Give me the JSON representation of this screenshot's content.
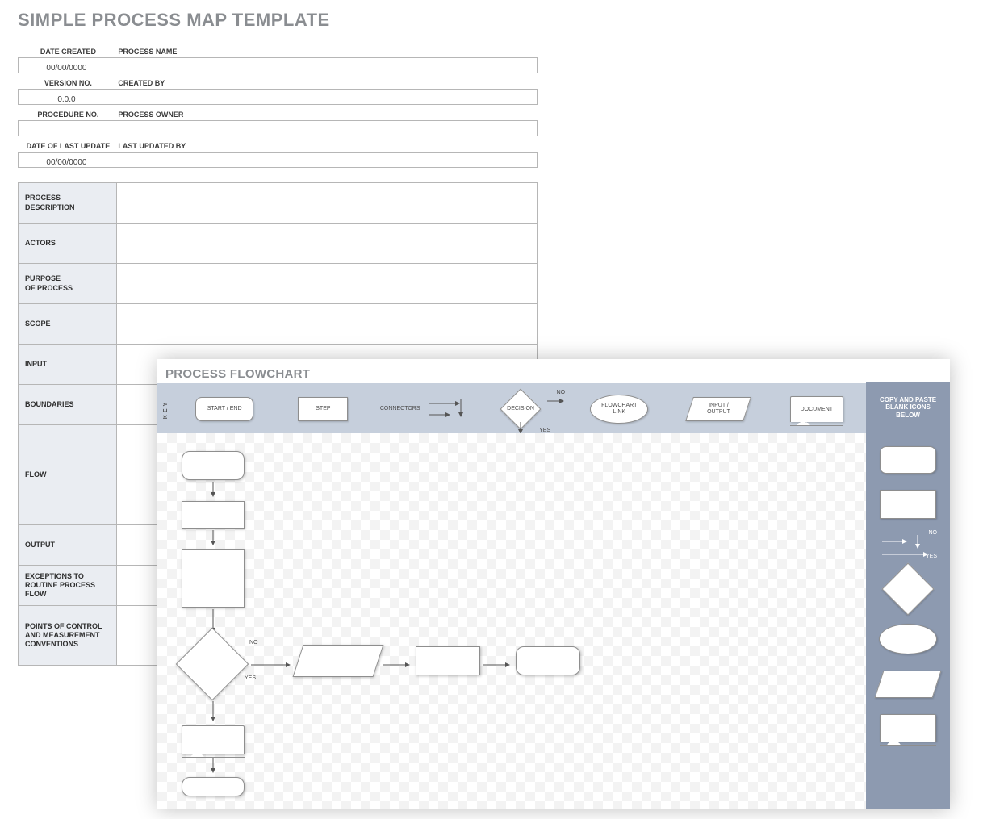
{
  "title": "SIMPLE PROCESS MAP TEMPLATE",
  "meta": {
    "rows": [
      {
        "left_label": "DATE CREATED",
        "left_value": "00/00/0000",
        "right_label": "PROCESS NAME",
        "right_value": ""
      },
      {
        "left_label": "VERSION NO.",
        "left_value": "0.0.0",
        "right_label": "CREATED BY",
        "right_value": ""
      },
      {
        "left_label": "PROCEDURE NO.",
        "left_value": "",
        "right_label": "PROCESS OWNER",
        "right_value": ""
      },
      {
        "left_label": "DATE OF LAST UPDATE",
        "left_value": "00/00/0000",
        "right_label": "LAST UPDATED BY",
        "right_value": ""
      }
    ]
  },
  "details": [
    {
      "label": "PROCESS\nDESCRIPTION",
      "value": "",
      "size": "s"
    },
    {
      "label": "ACTORS",
      "value": "",
      "size": "s"
    },
    {
      "label": "PURPOSE\nOF PROCESS",
      "value": "",
      "size": "s"
    },
    {
      "label": "SCOPE",
      "value": "",
      "size": "s"
    },
    {
      "label": "INPUT",
      "value": "",
      "size": "s"
    },
    {
      "label": "BOUNDARIES",
      "value": "",
      "size": "s"
    },
    {
      "label": "FLOW",
      "value": "",
      "size": "l"
    },
    {
      "label": "OUTPUT",
      "value": "",
      "size": "s"
    },
    {
      "label": "EXCEPTIONS TO\nROUTINE PROCESS FLOW",
      "value": "",
      "size": "s"
    },
    {
      "label": "POINTS OF CONTROL\nAND MEASUREMENT\nCONVENTIONS",
      "value": "",
      "size": "xl"
    }
  ],
  "flowchart": {
    "title": "PROCESS FLOWCHART",
    "key_label": "KEY",
    "key": [
      {
        "shape": "terminator",
        "label": "START / END"
      },
      {
        "shape": "step",
        "label": "STEP"
      },
      {
        "shape": "connectors",
        "label": "CONNECTORS"
      },
      {
        "shape": "diamond",
        "label": "DECISION",
        "no": "NO",
        "yes": "YES"
      },
      {
        "shape": "ellipse",
        "label": "FLOWCHART\nLINK"
      },
      {
        "shape": "parallelogram",
        "label": "INPUT /\nOUTPUT"
      },
      {
        "shape": "document",
        "label": "DOCUMENT"
      }
    ],
    "paste_header": "COPY AND PASTE\nBLANK ICONS\nBELOW",
    "paste_shapes": [
      "terminator",
      "step",
      "arrows",
      "diamond",
      "ellipse",
      "parallelogram",
      "document"
    ],
    "decision_labels": {
      "no": "NO",
      "yes": "YES"
    }
  }
}
